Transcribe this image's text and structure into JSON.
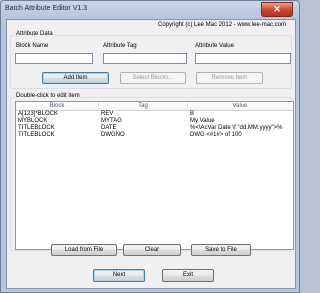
{
  "window": {
    "title": "Batch Attribute Editor V1.3",
    "close_glyph": "✕"
  },
  "copyright": "Copyright (c) Lee Mac 2012 - www.lee-mac.com",
  "attribute_data": {
    "group_label": "Attribute Data",
    "block_name_label": "Block Name",
    "attribute_tag_label": "Attribute Tag",
    "attribute_value_label": "Attribute Value",
    "block_name_value": "",
    "attribute_tag_value": "",
    "attribute_value_value": ""
  },
  "buttons": {
    "add_item": "Add Item",
    "select_blocks": "Select Blocks...",
    "remove_item": "Remove Item",
    "load_from_file": "Load from File",
    "clear": "Clear",
    "save_to_file": "Save to File",
    "next": "Next",
    "exit": "Exit"
  },
  "list": {
    "group_label": "Double-click to edit item",
    "columns": [
      "Block",
      "Tag",
      "Value"
    ],
    "rows": [
      {
        "block": "A[123]*BLOCK",
        "tag": "REV",
        "value": "B"
      },
      {
        "block": "MYBLOCK",
        "tag": "MYTAG",
        "value": "My Value"
      },
      {
        "block": "TITLEBLOCK",
        "tag": "DATE",
        "value": "%<\\AcVar Date \\f \"dd.MM.yyyy\">%"
      },
      {
        "block": "TITLEBLOCK",
        "tag": "DWGNO",
        "value": "DWG <#1#> of 100"
      }
    ]
  }
}
